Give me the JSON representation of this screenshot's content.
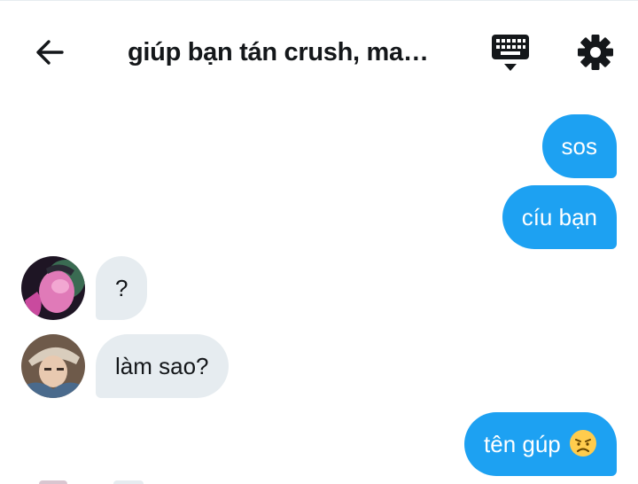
{
  "header": {
    "title": "giúp bạn tán crush, ma…",
    "back_icon": "arrow-left-icon",
    "keyboard_icon": "keyboard-icon",
    "settings_icon": "gear-icon"
  },
  "colors": {
    "accent": "#1da1f2",
    "incoming_bubble": "#e6ecf0",
    "text": "#14171a"
  },
  "messages": [
    {
      "direction": "outgoing",
      "text": "sos"
    },
    {
      "direction": "outgoing",
      "text": "cíu bạn"
    },
    {
      "direction": "incoming",
      "text": "?",
      "avatar": "avatar-pink"
    },
    {
      "direction": "incoming",
      "text": "làm sao?",
      "avatar": "avatar-hat"
    },
    {
      "direction": "outgoing",
      "text": "tên gúp",
      "emoji": "disappointed-face-icon"
    }
  ]
}
